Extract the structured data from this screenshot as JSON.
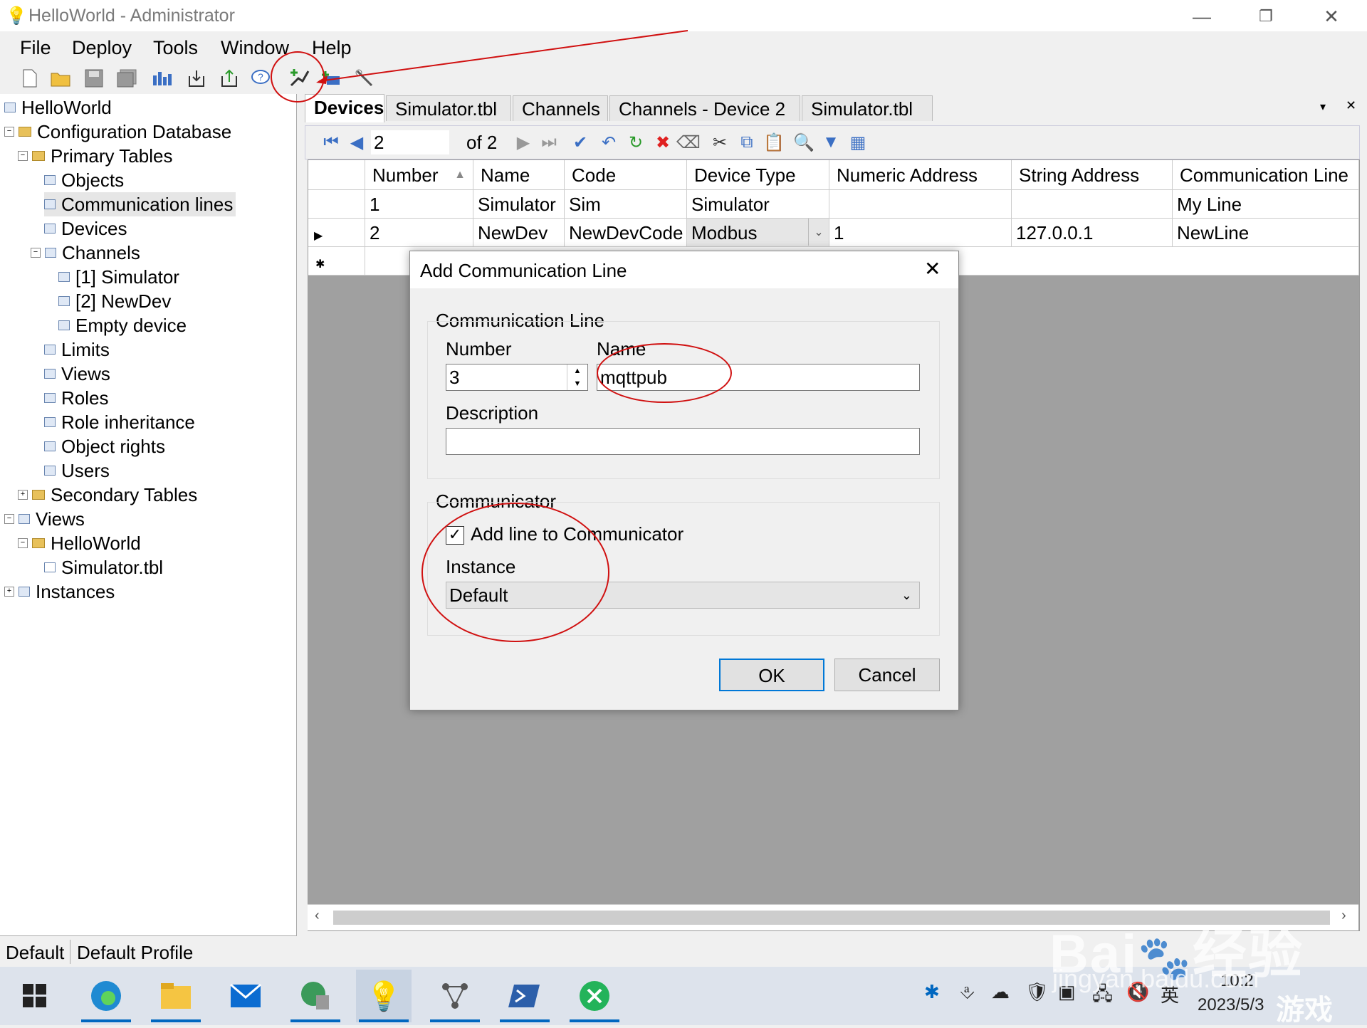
{
  "window": {
    "title": "HelloWorld - Administrator",
    "minimize_icon": "minimize-icon",
    "restore_icon": "restore-icon",
    "close_icon": "close-icon"
  },
  "menu": [
    "File",
    "Deploy",
    "Tools",
    "Window",
    "Help"
  ],
  "toolbar": {
    "icons": [
      "new-file-icon",
      "open-folder-icon",
      "save-icon",
      "save-all-icon",
      "chart-icon",
      "download-icon",
      "upload-icon",
      "help-icon",
      "add-line-icon",
      "add-device-icon",
      "wand-icon"
    ]
  },
  "tree": {
    "nodes": [
      "HelloWorld",
      "Configuration Database",
      "Primary Tables",
      "Objects",
      "Communication lines",
      "Devices",
      "Channels",
      "[1] Simulator",
      "[2] NewDev",
      "Empty device",
      "Limits",
      "Views",
      "Roles",
      "Role inheritance",
      "Object rights",
      "Users",
      "Secondary Tables",
      "Views",
      "HelloWorld",
      "Simulator.tbl",
      "Instances"
    ]
  },
  "tabs": [
    "Devices",
    "Simulator.tbl",
    "Channels",
    "Channels - Device 2",
    "Simulator.tbl"
  ],
  "navigator": {
    "position": "2",
    "of_label": "of 2"
  },
  "grid": {
    "columns": [
      "Number",
      "Name",
      "Code",
      "Device Type",
      "Numeric Address",
      "String Address",
      "Communication Line"
    ],
    "rows": [
      [
        "1",
        "Simulator",
        "Sim",
        "Simulator",
        "",
        "",
        "My Line"
      ],
      [
        "2",
        "NewDev",
        "NewDevCode",
        "Modbus",
        "1",
        "127.0.0.1",
        "NewLine"
      ]
    ]
  },
  "dialog": {
    "title": "Add Communication Line",
    "group1": "Communication Line",
    "number_label": "Number",
    "number_value": "3",
    "name_label": "Name",
    "name_value": "mqttpub",
    "description_label": "Description",
    "description_value": "",
    "group2": "Communicator",
    "checkbox_label": "Add line to Communicator",
    "checkbox_checked": true,
    "instance_label": "Instance",
    "instance_value": "Default",
    "ok": "OK",
    "cancel": "Cancel"
  },
  "status": {
    "left": "Default",
    "right": "Default Profile"
  },
  "taskbar": {
    "apps": [
      "edge-icon",
      "file-explorer-icon",
      "mail-icon",
      "network-globe-icon",
      "lightbulb-icon",
      "network-diagram-icon",
      "powershell-icon",
      "xmind-icon"
    ],
    "tray": {
      "ime": "英",
      "time": "10:2",
      "date": "2023/5/3"
    }
  },
  "watermark": {
    "text1": "Bai",
    "text2": "经验",
    "text3": "jingyan.baidu.com",
    "text4": "游戏"
  }
}
